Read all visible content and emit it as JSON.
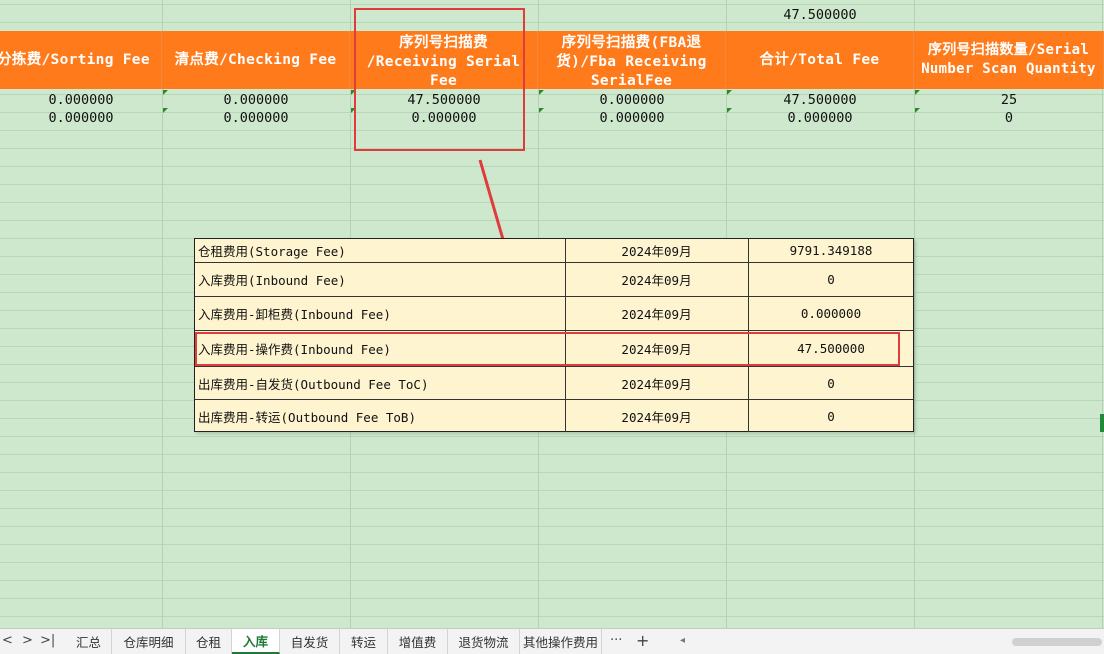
{
  "spreadsheet": {
    "total_top_value": "47.500000",
    "columns": [
      {
        "lines": [
          "分拣费/Sorting Fee"
        ]
      },
      {
        "lines": [
          "清点费/Checking Fee"
        ]
      },
      {
        "lines": [
          "序列号扫描费",
          "/Receiving Serial",
          "Fee"
        ]
      },
      {
        "lines": [
          "序列号扫描费(FBA退",
          "货)/Fba Receiving",
          "SerialFee"
        ]
      },
      {
        "lines": [
          "合计/Total Fee"
        ]
      },
      {
        "lines": [
          "序列号扫描数量/Serial",
          "Number Scan Quantity"
        ]
      }
    ],
    "rows": [
      [
        "0.000000",
        "0.000000",
        "47.500000",
        "0.000000",
        "47.500000",
        "25"
      ],
      [
        "0.000000",
        "0.000000",
        "0.000000",
        "0.000000",
        "0.000000",
        "0"
      ]
    ]
  },
  "fee_table": {
    "rows": [
      {
        "name": "仓租费用(Storage Fee)",
        "month": "2024年09月",
        "amount": "9791.349188"
      },
      {
        "name": "入库费用(Inbound Fee)",
        "month": "2024年09月",
        "amount": "0"
      },
      {
        "name": "入库费用-卸柜费(Inbound Fee)",
        "month": "2024年09月",
        "amount": "0.000000"
      },
      {
        "name": "入库费用-操作费(Inbound Fee)",
        "month": "2024年09月",
        "amount": "47.500000"
      },
      {
        "name": "出库费用-自发货(Outbound Fee ToC)",
        "month": "2024年09月",
        "amount": "0"
      },
      {
        "name": "出库费用-转运(Outbound Fee ToB)",
        "month": "2024年09月",
        "amount": "0"
      }
    ]
  },
  "sheet_tabs": {
    "nav": {
      "prev": "<",
      "next": ">",
      "last": ">|"
    },
    "tabs": [
      "汇总",
      "仓库明细",
      "仓租",
      "入库",
      "自发货",
      "转运",
      "增值费",
      "退货物流",
      "其他操作费用"
    ],
    "active": "入库",
    "more": "···",
    "add": "+",
    "scroll_left": "◂"
  },
  "colors": {
    "header_bg": "#ff7a1a",
    "sheet_bg": "#cde8cd",
    "highlight_red": "#e03c3c",
    "fee_table_bg": "#fef4cf"
  }
}
